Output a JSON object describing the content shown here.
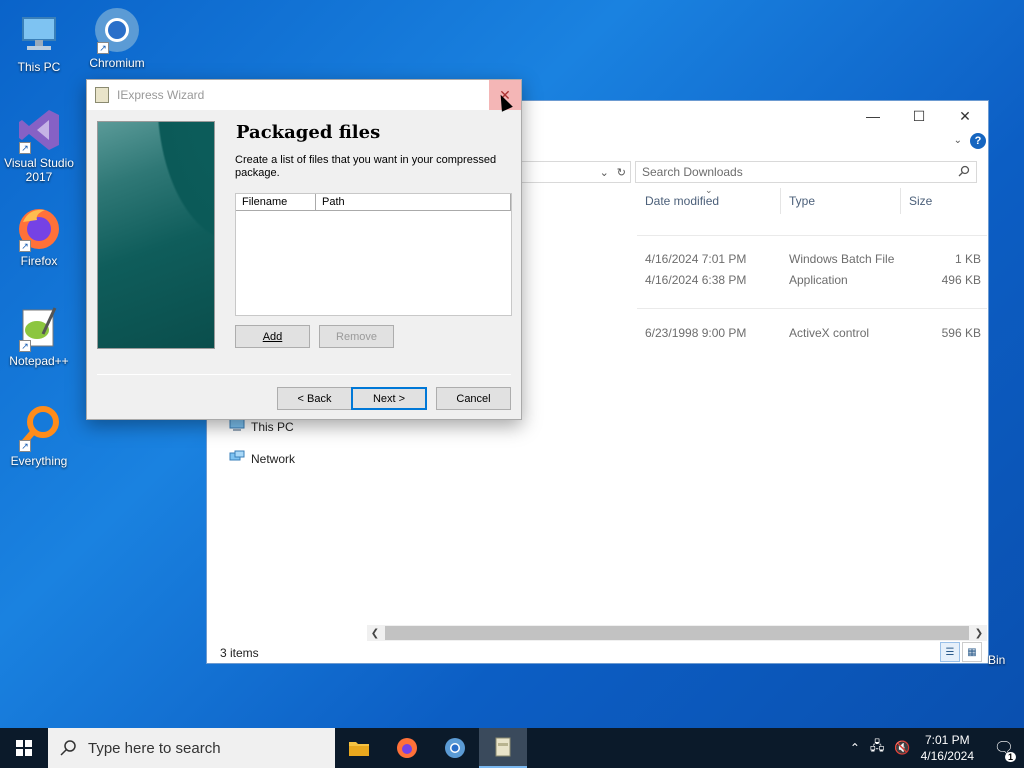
{
  "desktop": {
    "icons": [
      {
        "label": "This PC",
        "icon": "computer-icon"
      },
      {
        "label": "Chromium",
        "icon": "chromium-icon"
      },
      {
        "label": "Visual Studio 2017",
        "icon": "visual-studio-icon"
      },
      {
        "label": "Firefox",
        "icon": "firefox-icon"
      },
      {
        "label": "Notepad++",
        "icon": "notepadpp-icon"
      },
      {
        "label": "Everything",
        "icon": "everything-icon"
      },
      {
        "label": "Bin",
        "icon": "recycle-bin-icon"
      }
    ]
  },
  "explorer": {
    "controls": {
      "minimize": "—",
      "maximize": "☐",
      "close": "✕"
    },
    "help": "?",
    "search_placeholder": "Search Downloads",
    "columns": [
      "Date modified",
      "Type",
      "Size"
    ],
    "rows": [
      {
        "date": "4/16/2024 7:01 PM",
        "type": "Windows Batch File",
        "size": "1 KB"
      },
      {
        "date": "4/16/2024 6:38 PM",
        "type": "Application",
        "size": "496 KB"
      },
      {
        "date": "6/23/1998 9:00 PM",
        "type": "ActiveX control",
        "size": "596 KB"
      }
    ],
    "nav": [
      {
        "label": "This PC",
        "icon": "computer-icon"
      },
      {
        "label": "Network",
        "icon": "network-icon"
      }
    ],
    "status": "3 items"
  },
  "wizard": {
    "title": "IExpress Wizard",
    "heading": "Packaged files",
    "description": "Create a list of files that you want in your compressed package.",
    "list_columns": [
      "Filename",
      "Path"
    ],
    "buttons": {
      "add": "Add",
      "remove": "Remove",
      "back": "< Back",
      "next": "Next >",
      "cancel": "Cancel"
    }
  },
  "taskbar": {
    "search_placeholder": "Type here to search",
    "time": "7:01 PM",
    "date": "4/16/2024",
    "notification_count": "1"
  }
}
